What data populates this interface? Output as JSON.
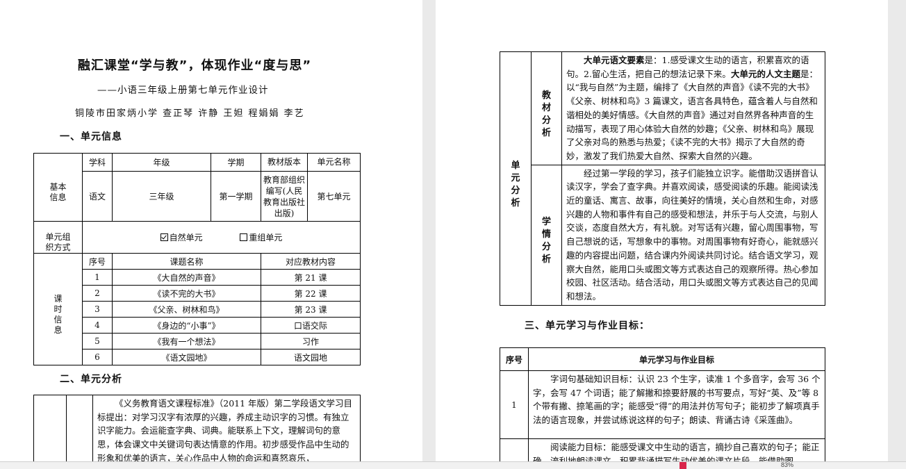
{
  "page1": {
    "title": "融汇课堂“学与教”，体现作业“度与思”",
    "subtitle": "——小语三年级上册第七单元作业设计",
    "authors": "铜陵市田家炳小学   查正琴 许静 王妲 程娟娟 李艺",
    "section1": "一、单元信息",
    "info": {
      "basic_label": "基本\n信息",
      "headers": [
        "学科",
        "年级",
        "学期",
        "教材版本",
        "单元名称"
      ],
      "values": [
        "语文",
        "三年级",
        "第一学期",
        "教育部组织编写(人民教育出版社出版)",
        "第七单元"
      ],
      "org_label": "单元组\n织方式",
      "org_checked": "自然单元",
      "org_unchecked": "重组单元",
      "lesson_label": "课\n时\n信\n息",
      "lesson_headers": [
        "序号",
        "课题名称",
        "对应教材内容"
      ],
      "lessons": [
        {
          "no": "1",
          "name": "《大自然的声音》",
          "content": "第 21 课"
        },
        {
          "no": "2",
          "name": "《读不完的大书》",
          "content": "第 22 课"
        },
        {
          "no": "3",
          "name": "《父亲、树林和鸟》",
          "content": "第 23 课"
        },
        {
          "no": "4",
          "name": "《身边的“小事”》",
          "content": "口语交际"
        },
        {
          "no": "5",
          "name": "《我有一个想法》",
          "content": "习作"
        },
        {
          "no": "6",
          "name": "《语文园地》",
          "content": "语文园地"
        }
      ]
    },
    "section2": "二、单元分析",
    "analysis_text": "《义务教育语文课程标准》（2011 年版）第二学段语文学习目标提出：对学习汉字有浓厚的兴趣，养成主动识字的习惯。有独立识字能力。会运能查字典、词典。能联系上下文，理解词句的意思，体会课文中关键词句表达情意的作用。初步感受作品中生动的形象和优美的语言，关心作品中人物的命运和喜怒哀乐，"
  },
  "page2": {
    "unit_label": "单\n元\n分\n析",
    "textbook_label": "教\n材\n分\n析",
    "textbook_bold1": "大单元语文要素",
    "textbook_text1": "是：1.感受课文生动的语言，积累喜欢的语句。2.留心生活，把自己的想法记录下来。",
    "textbook_bold2": "大单元的人文主题",
    "textbook_text2": "是：以“我与自然”为主题，编排了《大自然的声音》《读不完的大书》《父亲、树林和鸟》3 篇课文，语言各具特色，蕴含着人与自然和谐相处的美好情感。《大自然的声音》通过对自然界各种声音的生动描写，表现了用心体验大自然的妙趣；《父亲、树林和鸟》展现了父亲对鸟的熟悉与热爱；《读不完的大书》揭示了大自然的奇妙，激发了我们热爱大自然、探索大自然的兴趣。",
    "student_label": "学\n情\n分\n析",
    "student_text": "经过第一学段的学习，孩子们能独立识字。能借助汉语拼音认读汉字，学会了查字典。并喜欢阅读，感受阅读的乐趣。能阅读浅近的童话、寓言、故事，向往美好的情境，关心自然和生命，对感兴趣的人物和事件有自己的感受和想法，并乐于与人交流，与别人交谈，态度自然大方，有礼貌。对写话有兴趣，留心周围事物，写自己想说的话，写想象中的事物。对周围事物有好奇心，能就感兴趣的内容提出问题，结合课内外阅读共同讨论。结合语文学习，观察大自然，能用口头或图文等方式表达自己的观察所得。热心参加校园、社区活动。结合活动，用口头或图文等方式表达自己的见闻和想法。",
    "section3": "三、单元学习与作业目标：",
    "goals_headers": [
      "序号",
      "单元学习与作业目标"
    ],
    "goal1_no": "1",
    "goal1_text": "字词句基础知识目标：认识 23 个生字，读准 1 个多音字，会写 36 个字，会写 47 个词语；能了解撇和捺要舒展的书写要点，写好“英、及”等 8 个带有撇、捺笔画的字；能感受“得”的用法并仿写句子；能初步了解项真手法的语言现象，并尝试练说这样的句子；朗读、背诵古诗《采莲曲》。",
    "goal2_text": "阅读能力目标：能感受课文中生动的语言，摘抄自己喜欢的句子；能正确、流利地朗读课文，积累背诵描写生动优美的课文片段，能借助图"
  },
  "statusbar": {
    "zoom": "83%"
  }
}
